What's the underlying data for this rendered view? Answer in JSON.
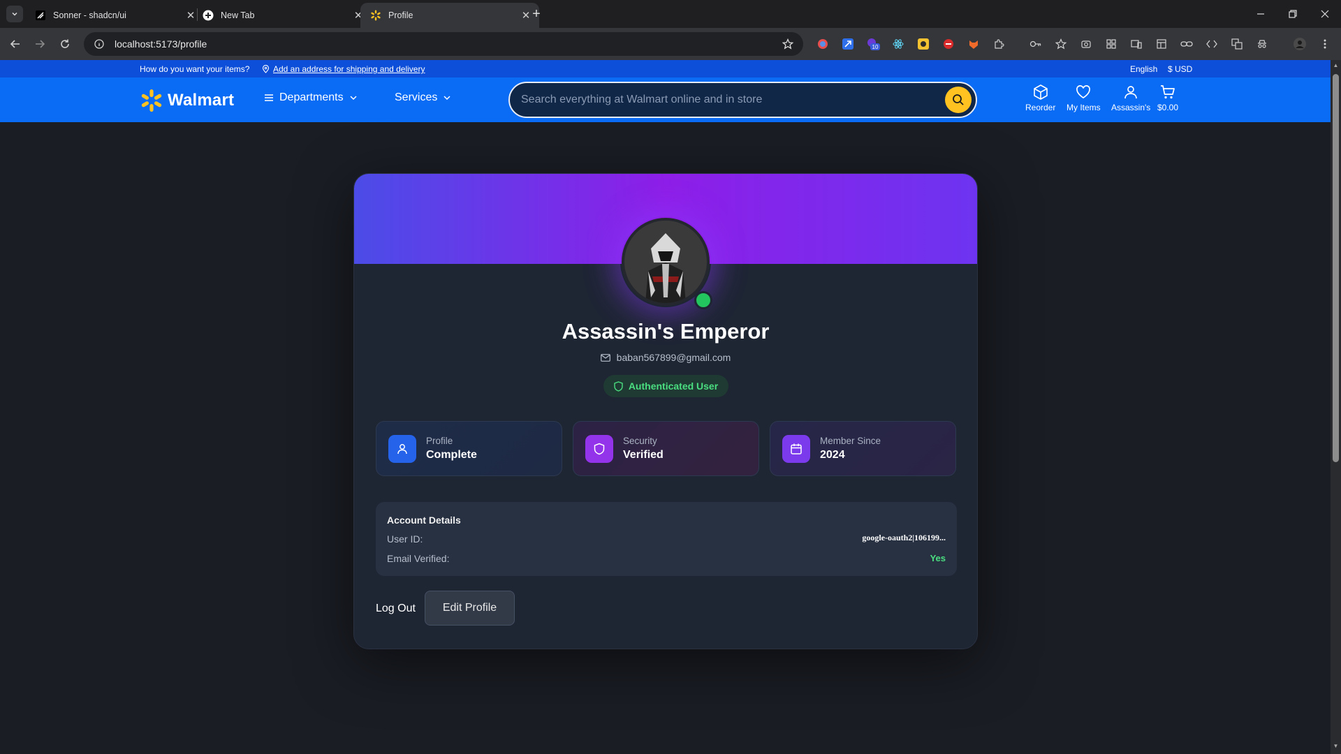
{
  "browser": {
    "tabs": [
      {
        "title": "Sonner - shadcn/ui",
        "active": false
      },
      {
        "title": "New Tab",
        "active": false
      },
      {
        "title": "Profile",
        "active": true
      }
    ],
    "url": "localhost:5173/profile",
    "extension_badge": "10"
  },
  "topbar": {
    "question": "How do you want your items?",
    "address_link": "Add an address for shipping and delivery",
    "language": "English",
    "currency": "$ USD"
  },
  "header": {
    "logo": "Walmart",
    "departments": "Departments",
    "services": "Services",
    "search_placeholder": "Search everything at Walmart online and in store",
    "actions": {
      "reorder": "Reorder",
      "my_items": "My Items",
      "account": "Assassin's",
      "cart": "$0.00"
    }
  },
  "profile": {
    "name": "Assassin's Emperor",
    "email": "baban567899@gmail.com",
    "badge": "Authenticated User",
    "stats": [
      {
        "label": "Profile",
        "value": "Complete",
        "icon": "user-icon",
        "color": "#2563eb"
      },
      {
        "label": "Security",
        "value": "Verified",
        "icon": "shield-icon",
        "color": "#9333ea"
      },
      {
        "label": "Member Since",
        "value": "2024",
        "icon": "calendar-icon",
        "color": "#7c3aed"
      }
    ],
    "details": {
      "title": "Account Details",
      "user_id_label": "User ID:",
      "user_id_value": "google-oauth2|106199...",
      "email_verified_label": "Email Verified:",
      "email_verified_value": "Yes"
    },
    "logout": "Log Out",
    "edit": "Edit Profile"
  },
  "colors": {
    "walmart_blue": "#0a6cf5",
    "walmart_yellow": "#ffc220",
    "success_green": "#22c55e"
  }
}
